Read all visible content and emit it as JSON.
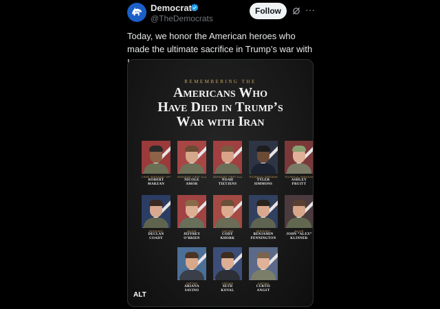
{
  "post": {
    "display_name": "Democrats",
    "handle": "@TheDemocrats",
    "follow_label": "Follow",
    "more_label": "···",
    "text": "Today, we honor the American heroes who made the ultimate sacrifice in Trump’s war with Iran."
  },
  "graphic": {
    "kicker": "REMEMBERING THE",
    "headline_1": "Americans Who",
    "headline_2": "Have Died in Trump’s",
    "headline_3": "War with Iran",
    "alt_label": "ALT",
    "people": [
      {
        "rank": "Chief Sergeant Officer 3",
        "name_1": "Robert",
        "name_2": "Marzan",
        "bg": "#9b3a3a",
        "skin": "#8d6246",
        "hair": "#2a2a2a",
        "uniform": "#6b6f55"
      },
      {
        "rank": "Sergeant First Class",
        "name_1": "Nicole",
        "name_2": "Amor",
        "bg": "#a84646",
        "skin": "#d5a88c",
        "hair": "#6b4b34",
        "uniform": "#6e7158"
      },
      {
        "rank": "Sergeant First Class",
        "name_1": "Noah",
        "name_2": "Tietjens",
        "bg": "#a04040",
        "skin": "#d9a38a",
        "hair": "#7a5a40",
        "uniform": "#6c6f57"
      },
      {
        "rank": "Technical Sergeant",
        "name_1": "Tyler",
        "name_2": "Simmons",
        "bg": "#2d3545",
        "skin": "#6b4a35",
        "hair": "#1d1d1d",
        "uniform": "#1c2230"
      },
      {
        "rank": "Technical Sergeant",
        "name_1": "Ashley",
        "name_2": "Pruitt",
        "bg": "#7a3838",
        "skin": "#e0b098",
        "hair": "#8aa070",
        "uniform": "#7a7a66"
      },
      {
        "rank": "Sergeant",
        "name_1": "Declan",
        "name_2": "Coady",
        "bg": "#2b3d63",
        "skin": "#d8a890",
        "hair": "#3a2a22",
        "uniform": "#5f644e"
      },
      {
        "rank": "Major",
        "name_1": "Jeffrey",
        "name_2": "O’Brien",
        "bg": "#a14343",
        "skin": "#dcae92",
        "hair": "#8a6a48",
        "uniform": "#68705a"
      },
      {
        "rank": "Captain",
        "name_1": "Cody",
        "name_2": "Khork",
        "bg": "#a44a44",
        "skin": "#dcaa8e",
        "hair": "#6a5038",
        "uniform": "#6a6c56"
      },
      {
        "rank": "Sergeant",
        "name_1": "Benjamin",
        "name_2": "Pennington",
        "bg": "#30405e",
        "skin": "#d9a88e",
        "hair": "#2a221c",
        "uniform": "#5f6450"
      },
      {
        "rank": "Major",
        "name_1": "John “Alex”",
        "name_2": "Klinner",
        "bg": "#4b3b3e",
        "skin": "#d8a68a",
        "hair": "#5a4030",
        "uniform": "#62684f"
      },
      {
        "rank": "Captain",
        "name_1": "Ariana",
        "name_2": "Savino",
        "bg": "#4b6f96",
        "skin": "#d8a88a",
        "hair": "#4a3426",
        "uniform": "#3a3f4a"
      },
      {
        "rank": "Captain",
        "name_1": "Seth",
        "name_2": "Koval",
        "bg": "#3c4e78",
        "skin": "#dcae94",
        "hair": "#3e2c20",
        "uniform": "#2c2f36"
      },
      {
        "rank": "Captain",
        "name_1": "Curtis",
        "name_2": "Angst",
        "bg": "#5a6a88",
        "skin": "#e0b29a",
        "hair": "#7a6450",
        "uniform": "#7b7e68"
      }
    ]
  },
  "colors": {
    "accent_blue": "#1d9bf0",
    "gold": "#c9a463",
    "background": "#000000"
  }
}
